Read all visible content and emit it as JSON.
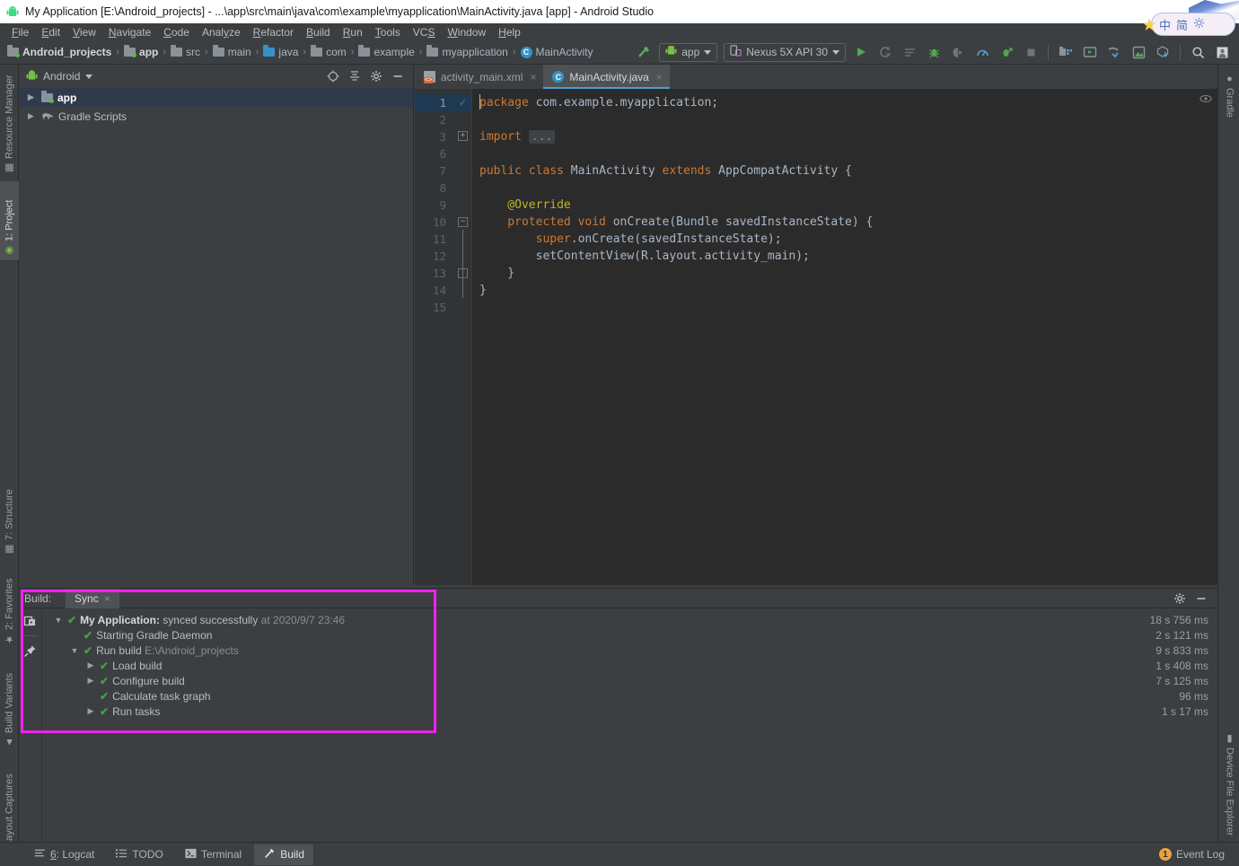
{
  "window": {
    "title": "My Application [E:\\Android_projects] - ...\\app\\src\\main\\java\\com\\example\\myapplication\\MainActivity.java [app] - Android Studio",
    "app_icon": "android-robot-icon",
    "minimize_label": "─"
  },
  "ime_widget": {
    "mode_cn": "中",
    "mode_simplified": "简",
    "settings_icon": "gear-icon"
  },
  "menubar": {
    "items": [
      {
        "label": "File",
        "mnemonic": "F"
      },
      {
        "label": "Edit",
        "mnemonic": "E"
      },
      {
        "label": "View",
        "mnemonic": "V"
      },
      {
        "label": "Navigate",
        "mnemonic": "N"
      },
      {
        "label": "Code",
        "mnemonic": "C"
      },
      {
        "label": "Analyze",
        "mnemonic": "y"
      },
      {
        "label": "Refactor",
        "mnemonic": "R"
      },
      {
        "label": "Build",
        "mnemonic": "B"
      },
      {
        "label": "Run",
        "mnemonic": "R"
      },
      {
        "label": "Tools",
        "mnemonic": "T"
      },
      {
        "label": "VCS",
        "mnemonic": "S"
      },
      {
        "label": "Window",
        "mnemonic": "W"
      },
      {
        "label": "Help",
        "mnemonic": "H"
      }
    ]
  },
  "breadcrumb": {
    "items": [
      {
        "label": "Android_projects",
        "icon": "project-icon",
        "bold": true
      },
      {
        "label": "app",
        "icon": "module-folder-icon",
        "bold": true
      },
      {
        "label": "src",
        "icon": "folder-icon",
        "bold": false
      },
      {
        "label": "main",
        "icon": "folder-icon",
        "bold": false
      },
      {
        "label": "java",
        "icon": "source-folder-icon",
        "bold": false
      },
      {
        "label": "com",
        "icon": "package-icon",
        "bold": false
      },
      {
        "label": "example",
        "icon": "package-icon",
        "bold": false
      },
      {
        "label": "myapplication",
        "icon": "package-icon",
        "bold": false
      },
      {
        "label": "MainActivity",
        "icon": "class-icon",
        "bold": false
      }
    ],
    "separator": "›"
  },
  "toolbar": {
    "build_hammer_icon": "hammer-icon",
    "run_config": {
      "label": "app",
      "icon": "android-robot-icon",
      "caret": "▾"
    },
    "device": {
      "label": "Nexus 5X API 30",
      "icon": "device-icon",
      "caret": "▾"
    },
    "icons": [
      {
        "name": "run-icon",
        "glyph": "▶",
        "color": "#4fa84f"
      },
      {
        "name": "apply-changes-icon",
        "glyph": "↺",
        "color": "#6e7479"
      },
      {
        "name": "apply-code-changes-icon",
        "glyph": "≡",
        "color": "#6e7479"
      },
      {
        "name": "debug-icon",
        "glyph": "☢",
        "color": "#4fa84f"
      },
      {
        "name": "attach-debugger-icon",
        "glyph": "◑",
        "color": "#6e7479"
      },
      {
        "name": "profiler-icon",
        "glyph": "◔",
        "color": "#5b9ec9"
      },
      {
        "name": "run-with-coverage-icon",
        "glyph": "↗",
        "color": "#4fa84f"
      },
      {
        "name": "stop-icon",
        "glyph": "■",
        "color": "#6e7479"
      },
      {
        "name": "sdk-manager-icon",
        "glyph": "▤",
        "color": "#8a9299"
      },
      {
        "name": "avd-manager-icon",
        "glyph": "▷",
        "color": "#4fa84f"
      },
      {
        "name": "sync-gradle-icon",
        "glyph": "↻",
        "color": "#5b9ec9"
      },
      {
        "name": "layout-inspector-icon",
        "glyph": "◳",
        "color": "#4fa84f"
      },
      {
        "name": "device-explorer-icon",
        "glyph": "⬇",
        "color": "#5b9ec9"
      },
      {
        "name": "search-everywhere-icon",
        "glyph": "⚲",
        "color": "#bbbbbb"
      },
      {
        "name": "account-icon",
        "glyph": "▣",
        "color": "#d8d8d8"
      }
    ]
  },
  "left_stripe": {
    "tabs": [
      {
        "label": "Resource Manager",
        "icon": "resource-manager-icon",
        "active": false
      },
      {
        "label": "1: Project",
        "icon": "project-android-icon",
        "active": true
      },
      {
        "label": "7: Structure",
        "icon": "structure-icon",
        "active": false
      },
      {
        "label": "2: Favorites",
        "icon": "star-icon",
        "active": false
      },
      {
        "label": "Build Variants",
        "icon": "android-variants-icon",
        "active": false
      },
      {
        "label": "Layout Captures",
        "icon": "layout-captures-icon",
        "active": false
      }
    ]
  },
  "right_stripe": {
    "tabs": [
      {
        "label": "Gradle",
        "icon": "gradle-elephant-icon",
        "active": false
      },
      {
        "label": "Device File Explorer",
        "icon": "device-file-explorer-icon",
        "active": false
      }
    ]
  },
  "project_panel": {
    "view_selector": {
      "label": "Android",
      "icon": "android-robot-icon",
      "caret": "▾"
    },
    "actions": [
      {
        "name": "select-opened-file-icon",
        "glyph": "⊕"
      },
      {
        "name": "collapse-all-icon",
        "glyph": "⤓"
      },
      {
        "name": "settings-gear-icon",
        "glyph": "⚙"
      },
      {
        "name": "hide-panel-icon",
        "glyph": "─"
      }
    ],
    "tree": [
      {
        "label": "app",
        "icon": "module-folder-icon",
        "expanded": false,
        "selected": true,
        "indent": 0
      },
      {
        "label": "Gradle Scripts",
        "icon": "gradle-elephant-icon",
        "expanded": false,
        "selected": false,
        "indent": 0
      }
    ]
  },
  "editor": {
    "tabs": [
      {
        "label": "activity_main.xml",
        "icon": "xml-layout-icon",
        "active": false,
        "close": "×"
      },
      {
        "label": "MainActivity.java",
        "icon": "java-class-icon",
        "active": true,
        "close": "×"
      }
    ],
    "inspection_icon": "eye-icon",
    "gutter_check": "✓",
    "line_numbers": [
      "1",
      "2",
      "3",
      "6",
      "7",
      "8",
      "9",
      "10",
      "11",
      "12",
      "13",
      "14",
      "15"
    ],
    "lines": [
      {
        "num": "1",
        "tokens": [
          {
            "t": "package ",
            "c": "kw"
          },
          {
            "t": "com.example.myapplication;",
            "c": "pl"
          }
        ]
      },
      {
        "num": "2",
        "tokens": []
      },
      {
        "num": "3",
        "tokens": [
          {
            "t": "import ",
            "c": "kw"
          },
          {
            "t": "...",
            "c": "fold"
          }
        ]
      },
      {
        "num": "6",
        "tokens": []
      },
      {
        "num": "7",
        "tokens": [
          {
            "t": "public ",
            "c": "kw"
          },
          {
            "t": "class ",
            "c": "kw"
          },
          {
            "t": "MainActivity ",
            "c": "pl"
          },
          {
            "t": "extends ",
            "c": "kw"
          },
          {
            "t": "AppCompatActivity {",
            "c": "pl"
          }
        ]
      },
      {
        "num": "8",
        "tokens": []
      },
      {
        "num": "9",
        "tokens": [
          {
            "t": "    @Override",
            "c": "an"
          }
        ]
      },
      {
        "num": "10",
        "tokens": [
          {
            "t": "    protected ",
            "c": "kw"
          },
          {
            "t": "void ",
            "c": "kw"
          },
          {
            "t": "onCreate(Bundle savedInstanceState) {",
            "c": "pl"
          }
        ]
      },
      {
        "num": "11",
        "tokens": [
          {
            "t": "        ",
            "c": "pl"
          },
          {
            "t": "super",
            "c": "kw"
          },
          {
            "t": ".onCreate(savedInstanceState);",
            "c": "pl"
          }
        ]
      },
      {
        "num": "12",
        "tokens": [
          {
            "t": "        setContentView(R.layout.activity_main);",
            "c": "pl"
          }
        ]
      },
      {
        "num": "13",
        "tokens": [
          {
            "t": "    }",
            "c": "pl"
          }
        ]
      },
      {
        "num": "14",
        "tokens": [
          {
            "t": "}",
            "c": "pl"
          }
        ]
      },
      {
        "num": "15",
        "tokens": []
      }
    ]
  },
  "build_panel": {
    "label": "Build:",
    "tab": {
      "label": "Sync",
      "close": "×"
    },
    "actions": [
      {
        "name": "build-settings-gear-icon",
        "glyph": "⚙"
      },
      {
        "name": "hide-build-panel-icon",
        "glyph": "─"
      }
    ],
    "side_icons": [
      {
        "name": "toggle-console-icon",
        "glyph": "⧉"
      },
      {
        "name": "pin-tab-icon",
        "glyph": "✐"
      }
    ],
    "rows": [
      {
        "indent": 0,
        "triangle": "▼",
        "check": "✔",
        "bold_text": "My Application:",
        "text": " synced successfully",
        "dim_text": " at 2020/9/7 23:46",
        "time": "18 s 756 ms"
      },
      {
        "indent": 1,
        "triangle": "",
        "check": "✔",
        "bold_text": "",
        "text": "Starting Gradle Daemon",
        "dim_text": "",
        "time": "2 s 121 ms"
      },
      {
        "indent": 1,
        "triangle": "▼",
        "check": "✔",
        "bold_text": "",
        "text": "Run build",
        "dim_text": " E:\\Android_projects",
        "time": "9 s 833 ms"
      },
      {
        "indent": 2,
        "triangle": "▶",
        "check": "✔",
        "bold_text": "",
        "text": "Load build",
        "dim_text": "",
        "time": "1 s 408 ms"
      },
      {
        "indent": 2,
        "triangle": "▶",
        "check": "✔",
        "bold_text": "",
        "text": "Configure build",
        "dim_text": "",
        "time": "7 s 125 ms"
      },
      {
        "indent": 2,
        "triangle": "",
        "check": "✔",
        "bold_text": "",
        "text": "Calculate task graph",
        "dim_text": "",
        "time": "96 ms"
      },
      {
        "indent": 2,
        "triangle": "▶",
        "check": "✔",
        "bold_text": "",
        "text": "Run tasks",
        "dim_text": "",
        "time": "1 s 17 ms"
      }
    ]
  },
  "highlight": {
    "color": "#f020f0",
    "note": "annotation-rectangle"
  },
  "statusbar": {
    "items": [
      {
        "label": "6: Logcat",
        "icon": "logcat-icon",
        "active": false
      },
      {
        "label": "TODO",
        "icon": "todo-icon",
        "active": false
      },
      {
        "label": "Terminal",
        "icon": "terminal-icon",
        "active": false
      },
      {
        "label": "Build",
        "icon": "hammer-icon",
        "active": true
      }
    ],
    "event_log": {
      "label": "Event Log",
      "badge": "1"
    }
  }
}
